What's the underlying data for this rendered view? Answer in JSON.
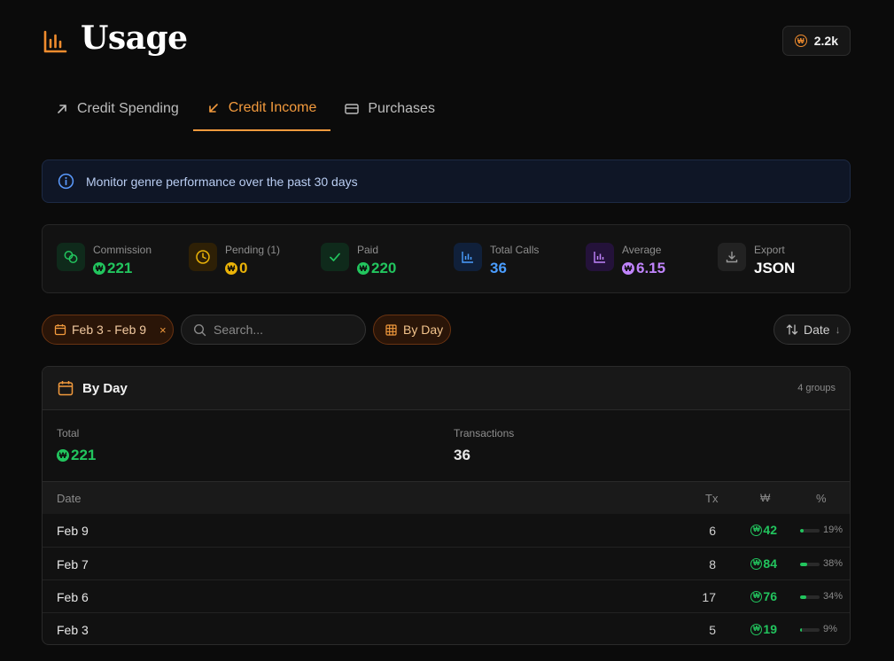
{
  "header": {
    "title": "Usage",
    "balance": "2.2k",
    "coin_symbol": "₩"
  },
  "tabs": [
    {
      "label": "Credit Spending",
      "icon": "arrow-up-right-icon",
      "active": false
    },
    {
      "label": "Credit Income",
      "icon": "arrow-down-left-icon",
      "active": true
    },
    {
      "label": "Purchases",
      "icon": "credit-card-icon",
      "active": false
    }
  ],
  "notice": {
    "text": "Monitor genre performance over the past 30 days",
    "icon": "info-icon"
  },
  "stats": [
    {
      "label": "Commission",
      "value": "221",
      "coin": true,
      "color": "#22c55e",
      "icon": "coins-icon"
    },
    {
      "label": "Pending (1)",
      "value": "0",
      "coin": true,
      "color": "#eab308",
      "icon": "clock-icon"
    },
    {
      "label": "Paid",
      "value": "220",
      "coin": true,
      "color": "#22c55e",
      "icon": "check-icon"
    },
    {
      "label": "Total Calls",
      "value": "36",
      "coin": false,
      "color": "#4a9dff",
      "icon": "bar-chart-icon"
    },
    {
      "label": "Average",
      "value": "6.15",
      "coin": true,
      "color": "#c084fc",
      "icon": "bar-chart-icon"
    },
    {
      "label": "Export",
      "value": "JSON",
      "coin": false,
      "color": "#ffffff",
      "icon": "download-icon"
    }
  ],
  "filters": {
    "date_range": "Feb 3 - Feb 9",
    "clear_symbol": "×",
    "search_placeholder": "Search...",
    "group_by": "By Day",
    "sort_label": "Date",
    "sort_direction": "↓"
  },
  "panel": {
    "title": "By Day",
    "count": "4 groups",
    "total_label": "Total",
    "total_value": "221",
    "transactions_label": "Transactions",
    "transactions_value": "36",
    "columns": {
      "date": "Date",
      "tx": "Tx",
      "amount": "₩",
      "percent": "%"
    },
    "rows": [
      {
        "date": "Feb 9",
        "tx": "6",
        "amount": "42",
        "percent": "19%",
        "share": 0.19
      },
      {
        "date": "Feb 7",
        "tx": "8",
        "amount": "84",
        "percent": "38%",
        "share": 0.38
      },
      {
        "date": "Feb 6",
        "tx": "17",
        "amount": "76",
        "percent": "34%",
        "share": 0.34
      },
      {
        "date": "Feb 3",
        "tx": "5",
        "amount": "19",
        "percent": "9%",
        "share": 0.09
      }
    ]
  }
}
